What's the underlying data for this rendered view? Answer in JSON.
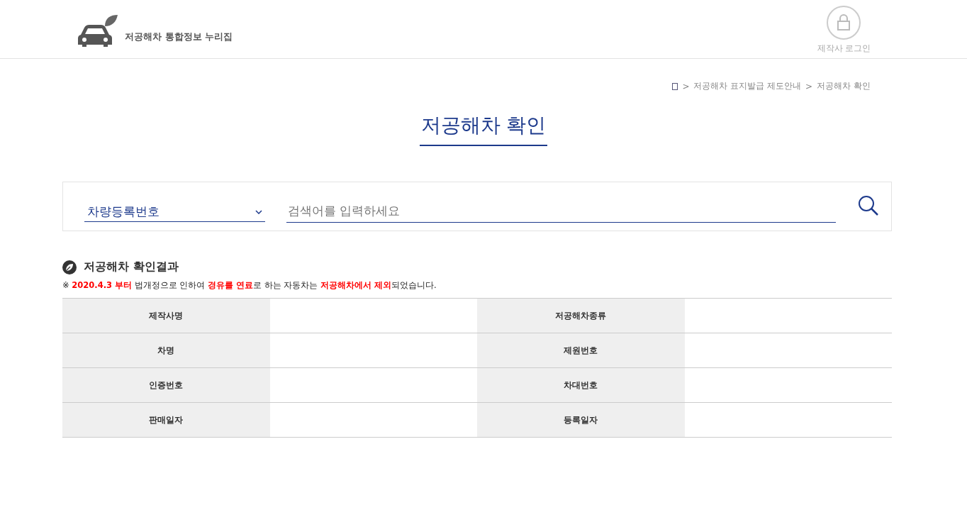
{
  "header": {
    "logo_text": "저공해차 통합정보 누리집",
    "login_label": "제작사 로그인"
  },
  "breadcrumb": [
    {
      "separator": ">",
      "label": "저공해차 표지발급 제도안내"
    },
    {
      "separator": ">",
      "label": "저공해차 확인"
    }
  ],
  "page_title": "저공해차 확인",
  "search": {
    "select_value": "차량등록번호",
    "placeholder": "검색어를 입력하세요"
  },
  "result": {
    "title": "저공해차 확인결과",
    "notice": "※ **2020.4.3 부터** 법개정으로 인하여 **경유를 연료**로 하는 자동차는 **저공해차에서 제외**되었습니다.",
    "fields": [
      "제작사명",
      "저공해차종류",
      "차명",
      "제원번호",
      "인증번호",
      "차대번호",
      "판매일자",
      "등록일자"
    ]
  }
}
